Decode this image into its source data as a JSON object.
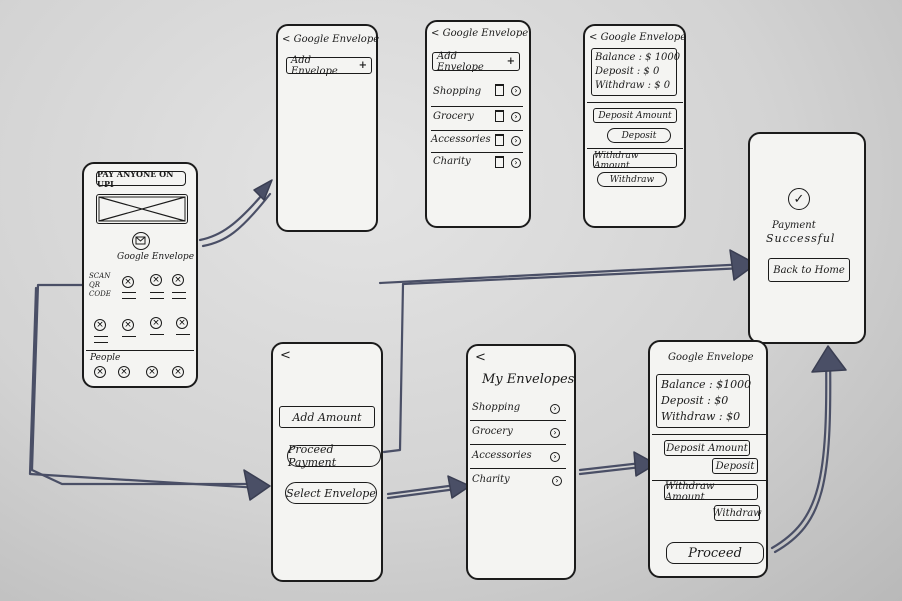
{
  "phone_home": {
    "banner": "PAY ANYONE ON UPI",
    "app_label": "Google Envelope",
    "scan_label": "SCAN QR CODE",
    "people_label": "People"
  },
  "phone_add": {
    "title": "Google Envelope",
    "add_button": "Add Envelope",
    "plus": "+"
  },
  "phone_list": {
    "title": "Google Envelope",
    "add_button": "Add Envelope",
    "plus": "+",
    "items": [
      "Shopping",
      "Grocery",
      "Accessories",
      "Charity"
    ]
  },
  "phone_balance_top": {
    "title": "Google Envelope",
    "balance": "Balance : $ 1000",
    "deposit": "Deposit : $ 0",
    "withdraw": "Withdraw : $ 0",
    "deposit_amount": "Deposit Amount",
    "deposit_button": "Deposit",
    "withdraw_amount": "Withdraw Amount",
    "withdraw_button": "Withdraw"
  },
  "phone_success": {
    "message_line1": "Payment",
    "message_line2": "Successful",
    "back_button": "Back to Home"
  },
  "phone_actions": {
    "add_amount": "Add Amount",
    "proceed_payment": "Proceed Payment",
    "select_envelope": "Select Envelope"
  },
  "phone_my_envelopes": {
    "title": "My Envelopes",
    "items": [
      "Shopping",
      "Grocery",
      "Accessories",
      "Charity"
    ]
  },
  "phone_balance_bottom": {
    "title": "Google Envelope",
    "balance": "Balance : $1000",
    "deposit": "Deposit : $0",
    "withdraw": "Withdraw : $0",
    "deposit_amount": "Deposit Amount",
    "deposit_button": "Deposit",
    "withdraw_amount": "Withdraw Amount",
    "withdraw_button": "Withdraw",
    "proceed_button": "Proceed"
  },
  "glyphs": {
    "back": "<",
    "check": "✓",
    "chevron": "›",
    "cross": "×",
    "trash": "🗑"
  },
  "colors": {
    "ink": "#1b1b1b",
    "paper": "#f4f4f2",
    "arrow": "#4a4f66",
    "background": "#d3d3d3"
  }
}
